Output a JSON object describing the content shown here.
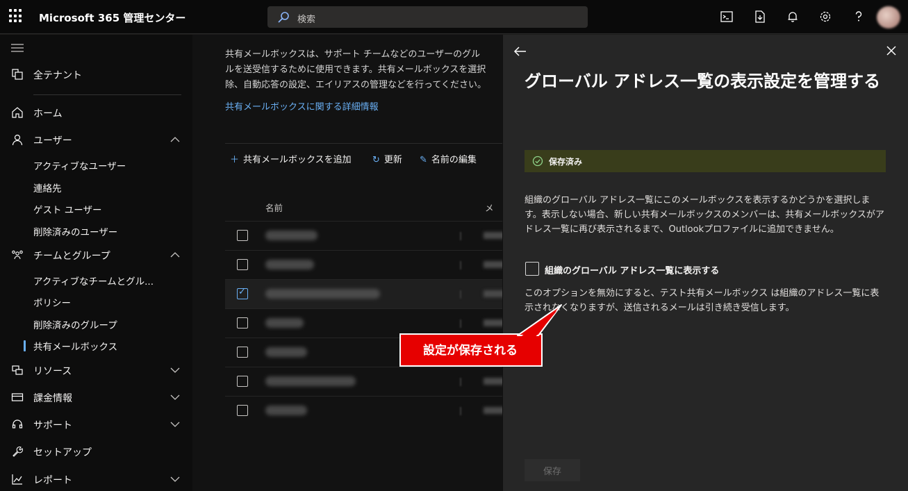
{
  "topbar": {
    "app_title": "Microsoft 365 管理センター",
    "search_placeholder": "検索",
    "icons": [
      "terminal-icon",
      "document-download-icon",
      "bell-icon",
      "gear-icon",
      "help-icon",
      "avatar"
    ]
  },
  "sidebar": {
    "all_tenants": "全テナント",
    "items": [
      {
        "label": "ホーム",
        "icon": "home-icon"
      },
      {
        "label": "ユーザー",
        "icon": "person-icon",
        "expanded": true,
        "children": [
          "アクティブなユーザー",
          "連絡先",
          "ゲスト ユーザー",
          "削除済みのユーザー"
        ]
      },
      {
        "label": "チームとグループ",
        "icon": "teams-icon",
        "expanded": true,
        "children": [
          "アクティブなチームとグル...",
          "ポリシー",
          "削除済みのグループ",
          "共有メールボックス"
        ]
      },
      {
        "label": "リソース",
        "icon": "resources-icon",
        "expanded": false
      },
      {
        "label": "課金情報",
        "icon": "billing-icon",
        "expanded": false
      },
      {
        "label": "サポート",
        "icon": "headset-icon",
        "expanded": false
      },
      {
        "label": "セットアップ",
        "icon": "wrench-icon"
      },
      {
        "label": "レポート",
        "icon": "chart-icon",
        "expanded": false
      }
    ],
    "active_item": "共有メールボックス"
  },
  "main": {
    "description": "共有メールボックスは、サポート チームなどのユーザーのグルーブがメールを送受信するために使用できます。共有メールボックスを選択して、権限の管理や削除、自動応答の設定、エイリアスの管理などを行ってください。",
    "description_lines": [
      "共有メールボックスは、サポート チームなどのユーザーのグル",
      "ルを送受信するために使用できます。共有メールボックスを選択",
      "除、自動応答の設定、エイリアスの管理などを行ってください。"
    ],
    "learn_more": "共有メールボックスに関する詳細情報",
    "commands": {
      "add": "共有メールボックスを追加",
      "refresh": "更新",
      "rename": "名前の編集"
    },
    "column_name": "名前",
    "column_email": "メ",
    "rows": [
      {
        "checked": false
      },
      {
        "checked": false
      },
      {
        "checked": true
      },
      {
        "checked": false
      },
      {
        "checked": false
      },
      {
        "checked": false
      },
      {
        "checked": false
      }
    ]
  },
  "panel": {
    "title": "グローバル アドレス一覧の表示設定を管理する",
    "status": "保存済み",
    "description": "組織のグローバル アドレス一覧にこのメールボックスを表示するかどうかを選択します。表示しない場合、新しい共有メールボックスのメンバーは、共有メールボックスがアドレス一覧に再び表示されるまで、Outlookプロファイルに追加できません。",
    "checkbox_label": "組織のグローバル アドレス一覧に表示する",
    "checkbox_checked": false,
    "option_description": "このオプションを無効にすると、テスト共有メールボックス は組織のアドレス一覧に表示されなくなりますが、送信されるメールは引き続き受信します。",
    "save_button": "保存"
  },
  "callout": {
    "text": "設定が保存される",
    "color": "#e60000"
  }
}
